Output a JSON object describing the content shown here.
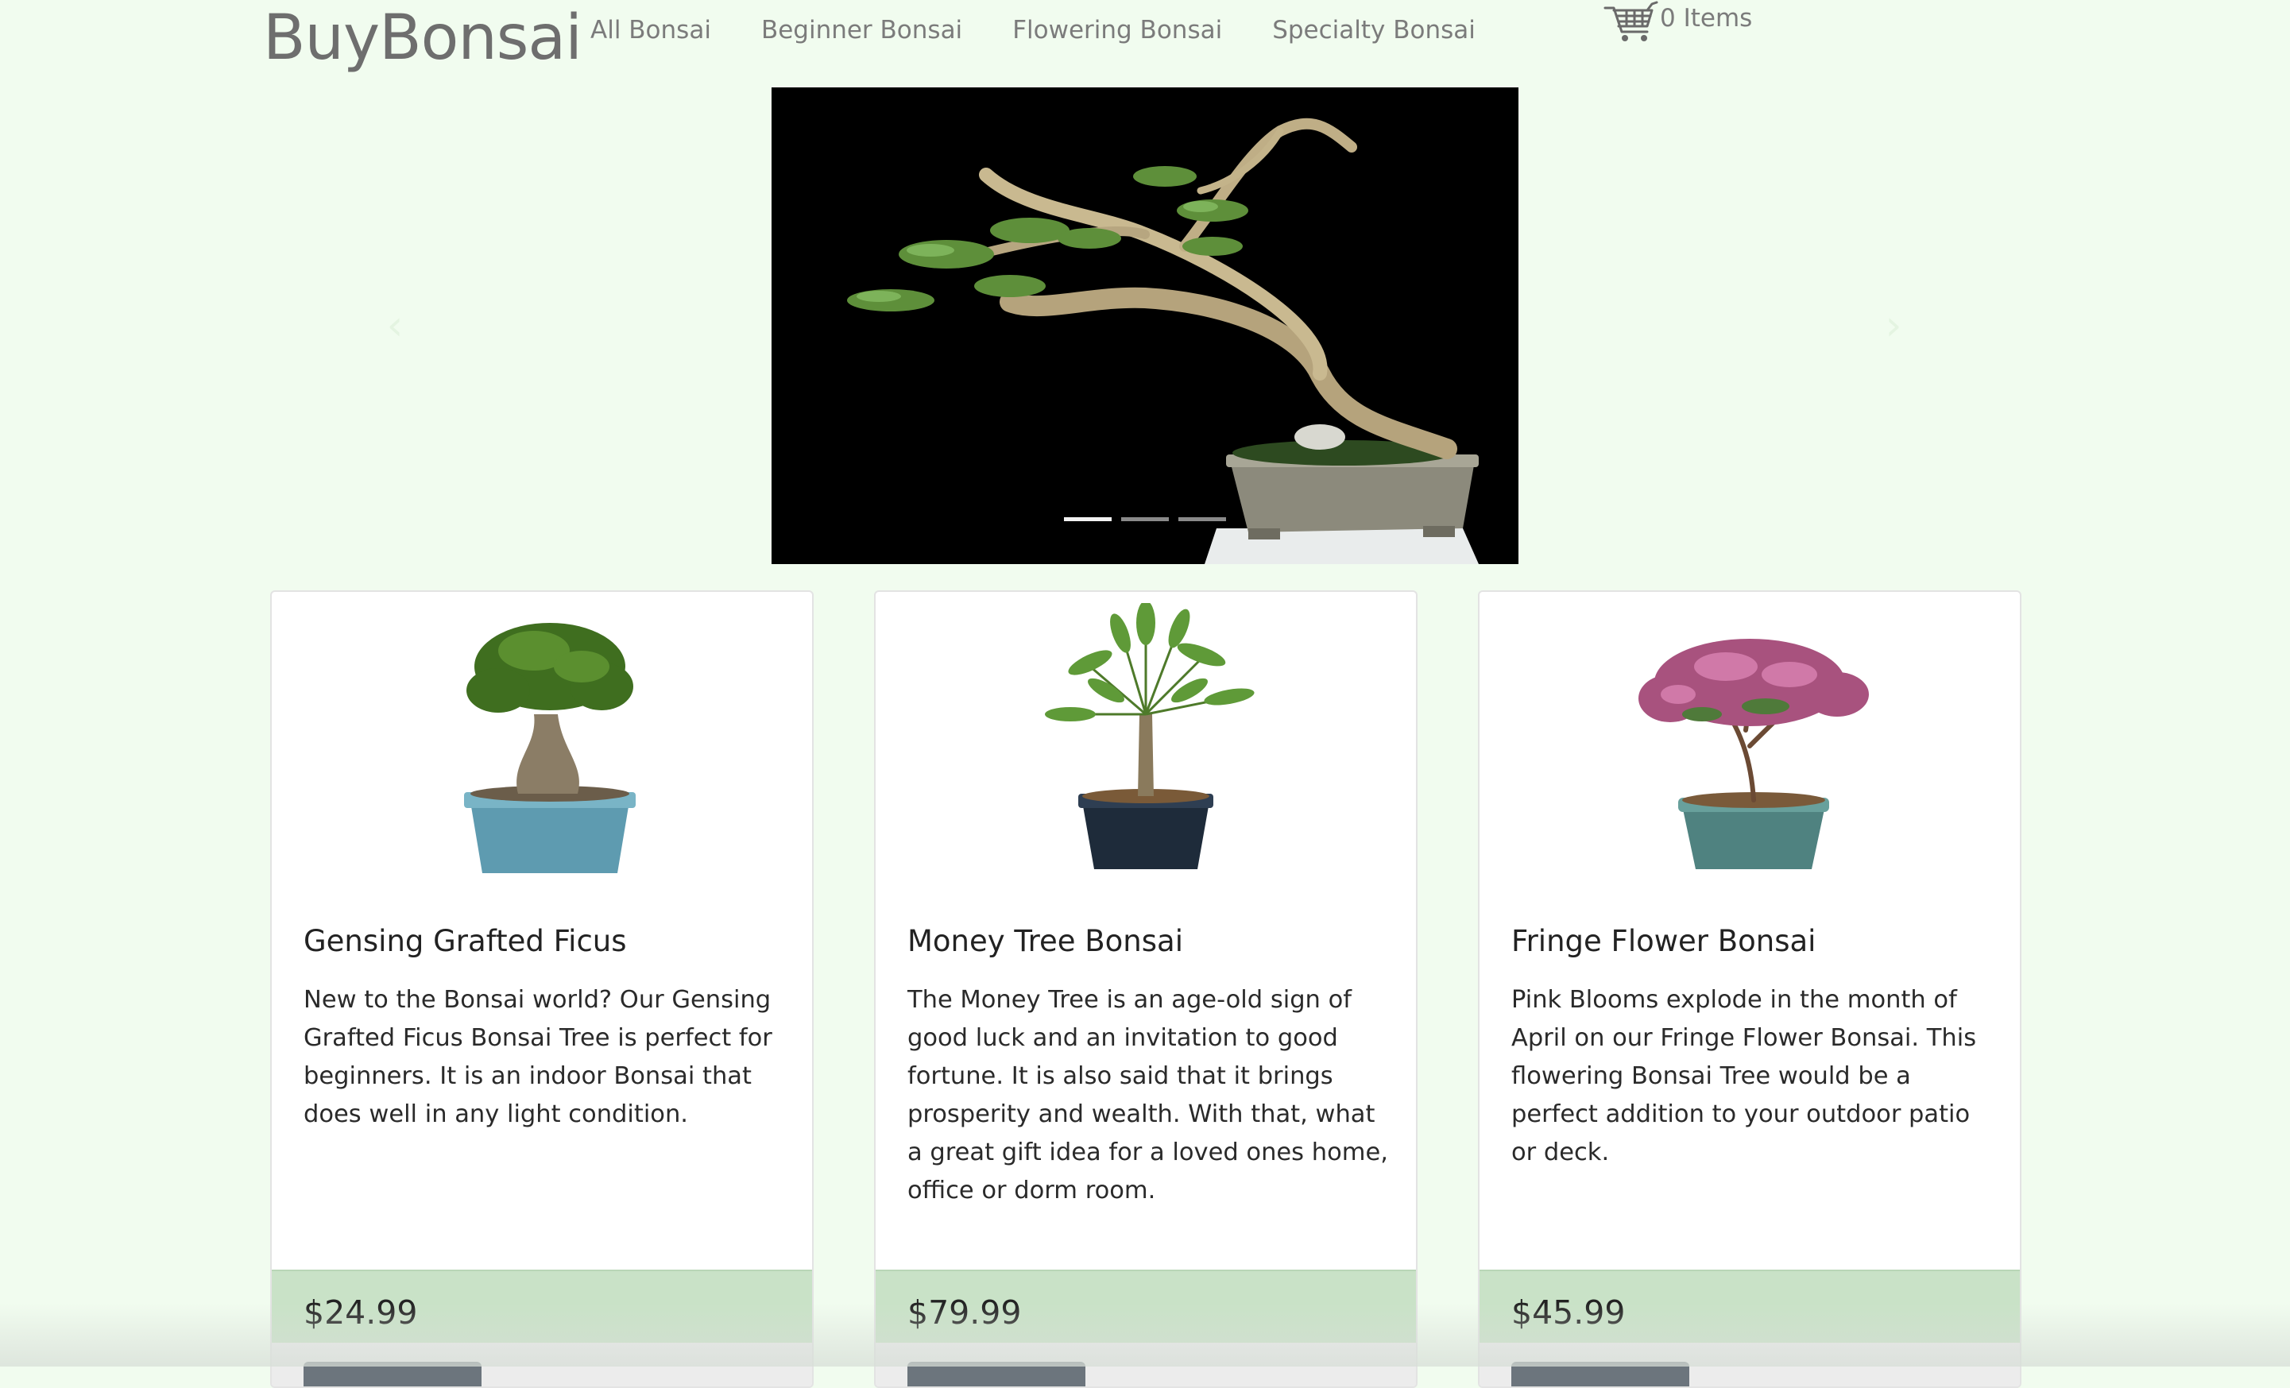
{
  "brand": "BuyBonsai",
  "nav": {
    "items": [
      {
        "label": "All Bonsai"
      },
      {
        "label": "Beginner Bonsai"
      },
      {
        "label": "Flowering Bonsai"
      },
      {
        "label": "Specialty Bonsai"
      }
    ]
  },
  "cart": {
    "label": "0 Items",
    "icon": "shopping-cart-icon"
  },
  "carousel": {
    "slide_count": 3,
    "active_index": 0,
    "prev_icon": "chevron-left-icon",
    "next_icon": "chevron-right-icon"
  },
  "products": [
    {
      "name": "Gensing Grafted Ficus",
      "description": "New to the Bonsai world? Our Gensing Grafted Ficus Bonsai Tree is perfect for beginners. It is an indoor Bonsai that does well in any light condition.",
      "price": "$24.99"
    },
    {
      "name": "Money Tree Bonsai",
      "description": "The Money Tree is an age-old sign of good luck and an invitation to good fortune. It is also said that it brings prosperity and wealth. With that, what a great gift idea for a loved ones home, office or dorm room.",
      "price": "$79.99"
    },
    {
      "name": "Fringe Flower Bonsai",
      "description": "Pink Blooms explode in the month of April on our Fringe Flower Bonsai. This flowering Bonsai Tree would be a perfect addition to your outdoor patio or deck.",
      "price": "$45.99"
    }
  ],
  "colors": {
    "page_background": "#f1fcef",
    "price_bar": "#c9e2c7",
    "button": "#6c757d",
    "nav_text": "#7b7b7b"
  }
}
